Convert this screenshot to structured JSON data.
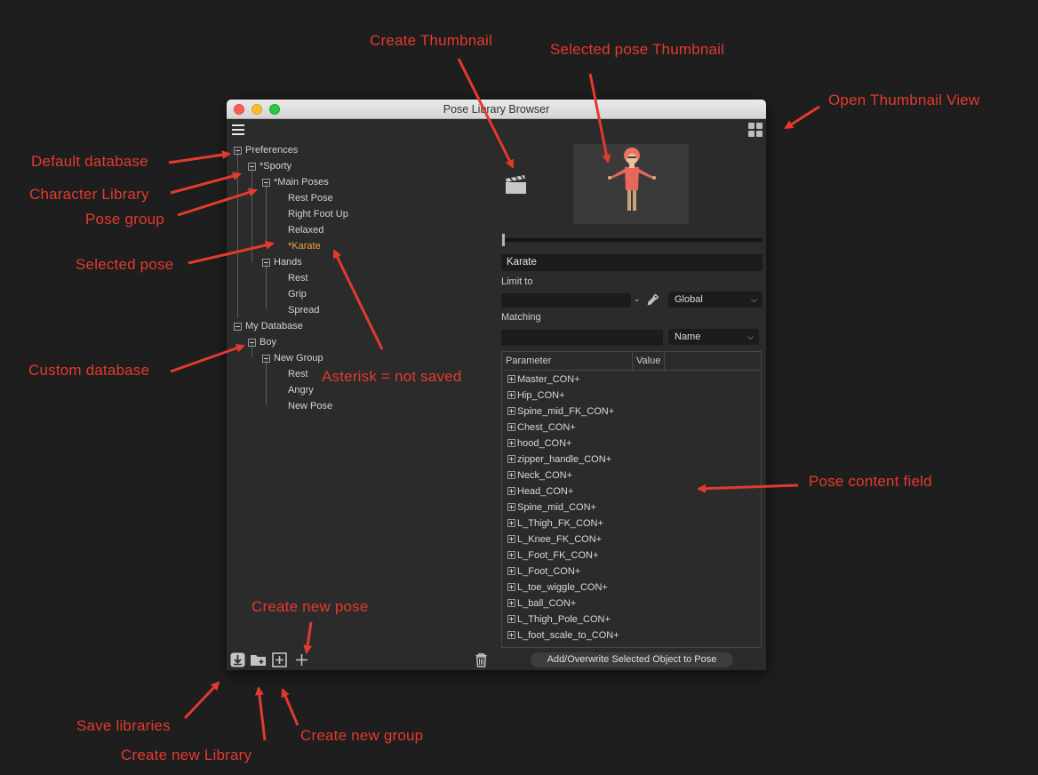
{
  "window": {
    "title": "Pose Library Browser",
    "menu_icon": "hamburger-menu-icon",
    "thumbnail_view_icon": "grid-view-icon"
  },
  "tree": [
    {
      "id": "preferences",
      "label": "Preferences",
      "expander": true
    },
    {
      "id": "sporty",
      "label": "*Sporty",
      "expander": true
    },
    {
      "id": "main-poses",
      "label": "*Main Poses",
      "expander": true
    },
    {
      "id": "rest-pose",
      "label": "Rest Pose"
    },
    {
      "id": "right-foot-up",
      "label": "Right Foot Up"
    },
    {
      "id": "relaxed",
      "label": "Relaxed"
    },
    {
      "id": "karate",
      "label": "*Karate",
      "selected": true
    },
    {
      "id": "hands",
      "label": "Hands",
      "expander": true
    },
    {
      "id": "rest",
      "label": "Rest"
    },
    {
      "id": "grip",
      "label": "Grip"
    },
    {
      "id": "spread",
      "label": "Spread"
    },
    {
      "id": "my-database",
      "label": "My Database",
      "expander": true
    },
    {
      "id": "boy",
      "label": "Boy",
      "expander": true
    },
    {
      "id": "new-group",
      "label": "New Group",
      "expander": true
    },
    {
      "id": "boy-rest",
      "label": "Rest"
    },
    {
      "id": "angry",
      "label": "Angry"
    },
    {
      "id": "new-pose",
      "label": "New Pose"
    }
  ],
  "selected_color": "#f4a63c",
  "pose": {
    "name": "Karate",
    "limit_to_label": "Limit to",
    "limit_scope": "Global",
    "matching_label": "Matching",
    "matching_mode": "Name"
  },
  "table": {
    "headers": [
      "Parameter",
      "Value"
    ],
    "rows": [
      "Master_CON+",
      "Hip_CON+",
      "Spine_mid_FK_CON+",
      "Chest_CON+",
      "hood_CON+",
      "zipper_handle_CON+",
      "Neck_CON+",
      "Head_CON+",
      "Spine_mid_CON+",
      "L_Thigh_FK_CON+",
      "L_Knee_FK_CON+",
      "L_Foot_FK_CON+",
      "L_Foot_CON+",
      "L_toe_wiggle_CON+",
      "L_ball_CON+",
      "L_Thigh_Pole_CON+",
      "L_foot_scale_to_CON+"
    ]
  },
  "add_button_label": "Add/Overwrite Selected Object to Pose",
  "toolbar_icons": [
    "save-libraries-icon",
    "new-library-icon",
    "new-group-icon",
    "new-pose-icon",
    "trash-icon"
  ],
  "annotations": {
    "create_thumbnail": "Create Thumbnail",
    "selected_pose_thumbnail": "Selected pose Thumbnail",
    "open_thumbnail_view": "Open Thumbnail View",
    "default_database": "Default database",
    "character_library": "Character Library",
    "pose_group": "Pose group",
    "selected_pose": "Selected pose",
    "custom_database": "Custom database",
    "asterisk_not_saved": "Asterisk = not saved",
    "pose_content_field": "Pose content field",
    "create_new_pose": "Create new pose",
    "save_libraries": "Save libraries",
    "create_new_library": "Create new Library",
    "create_new_group": "Create new group"
  },
  "annotation_color": "#e33a2e"
}
